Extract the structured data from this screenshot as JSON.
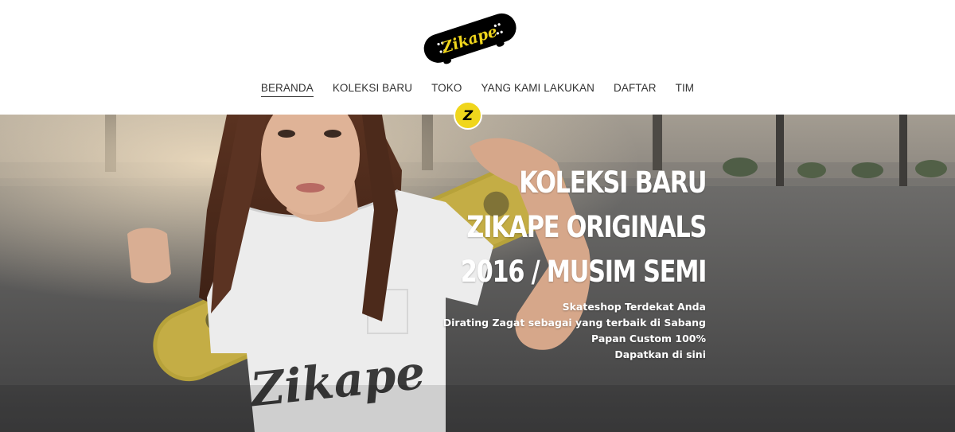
{
  "brand": {
    "logo_text": "Zikape",
    "badge_letter": "Z"
  },
  "nav": {
    "items": [
      {
        "label": "BERANDA",
        "active": true
      },
      {
        "label": "KOLEKSI BARU"
      },
      {
        "label": "TOKO"
      },
      {
        "label": "YANG KAMI LAKUKAN"
      },
      {
        "label": "DAFTAR"
      },
      {
        "label": "TIM"
      }
    ]
  },
  "hero": {
    "headlines": [
      "KOLEKSI BARU",
      "ZIKAPE ORIGINALS",
      "2016 / MUSIM SEMI"
    ],
    "lines": [
      "Skateshop Terdekat Anda",
      "Dirating Zagat sebagai yang terbaik di  Sabang",
      "Papan Custom 100%",
      "Dapatkan di sini"
    ],
    "shirt_text": "Zikape"
  },
  "colors": {
    "accent": "#f0d61c",
    "logo_bg": "#000000",
    "hero_text": "#ffffff"
  }
}
